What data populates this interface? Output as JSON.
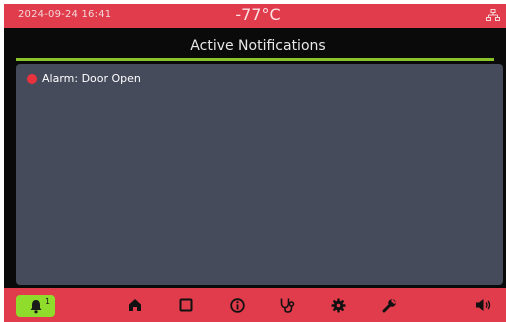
{
  "status": {
    "datetime": "2024-09-24  16:41",
    "temperature": "-77°C",
    "network_icon": "network-icon"
  },
  "header": {
    "title": "Active Notifications"
  },
  "notifications": [
    {
      "text": "Alarm: Door Open",
      "color": "#e8333e"
    }
  ],
  "nav": {
    "bell_badge": "1",
    "icons": [
      "bell-icon",
      "home-icon",
      "square-icon",
      "info-icon",
      "stethoscope-icon",
      "gear-icon",
      "wrench-icon",
      "speaker-icon"
    ]
  },
  "colors": {
    "accent_red": "#e03c4c",
    "active_green": "#8fdc2c",
    "panel": "#464b5c",
    "rule": "#8ac42a"
  }
}
